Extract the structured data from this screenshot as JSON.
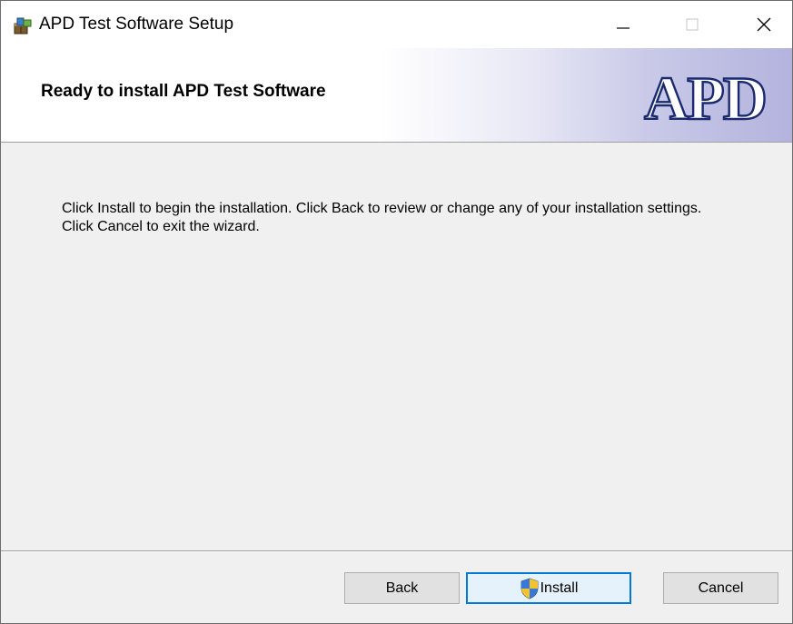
{
  "window": {
    "title": "APD Test Software Setup",
    "app_icon": "installer-package-icon"
  },
  "titlebar_controls": {
    "minimize_icon": "minimize-icon",
    "maximize_icon": "maximize-icon",
    "close_icon": "close-icon",
    "minimize_glyph": "—",
    "close_glyph": "✕"
  },
  "banner": {
    "heading": "Ready to install APD Test Software",
    "logo_text": "APD"
  },
  "body": {
    "message": "Click Install to begin the installation. Click Back to review or change any of your installation settings. Click Cancel to exit the wizard."
  },
  "buttons": {
    "back_label": "Back",
    "install_label": "Install",
    "install_icon": "uac-shield-icon",
    "cancel_label": "Cancel"
  },
  "colors": {
    "banner_gradient_end": "#b3b3de",
    "logo_outline": "#1a2a6e",
    "focus_border": "#0078d7",
    "window_background": "#f0f0f0"
  }
}
